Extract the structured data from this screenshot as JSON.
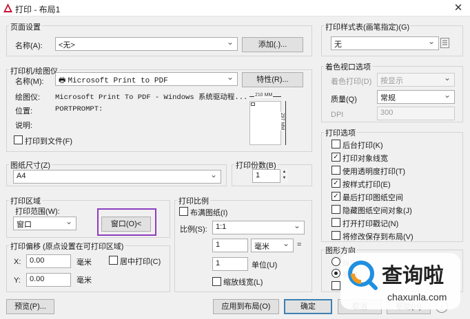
{
  "window": {
    "title": "打印 - 布局1",
    "close_glyph": "✕"
  },
  "page_setup": {
    "legend": "页面设置",
    "name_label": "名称(A):",
    "name_value": "<无>",
    "add_button": "添加(.)..."
  },
  "printer": {
    "legend": "打印机/绘图仪",
    "name_label": "名称(M):",
    "name_value": "Microsoft Print to PDF",
    "properties_button": "特性(R)...",
    "plotter_label": "绘图仪:",
    "plotter_value": "Microsoft Print To PDF - Windows 系统驱动程...",
    "location_label": "位置:",
    "location_value": "PORTPROMPT:",
    "description_label": "说明:",
    "print_to_file": "打印到文件(F)",
    "print_to_file_checked": false,
    "paper_width": "210 MM",
    "paper_height": "297 MM"
  },
  "paper_size": {
    "legend": "图纸尺寸(Z)",
    "value": "A4"
  },
  "copies": {
    "legend": "打印份数(B)",
    "value": "1"
  },
  "print_area": {
    "legend": "打印区域",
    "range_label": "打印范围(W):",
    "range_value": "窗口",
    "window_button": "窗口(O)<"
  },
  "print_offset": {
    "legend": "打印偏移 (原点设置在可打印区域)",
    "x_label": "X:",
    "x_value": "0.00",
    "x_unit": "毫米",
    "y_label": "Y:",
    "y_value": "0.00",
    "y_unit": "毫米",
    "center_label": "居中打印(C)",
    "center_checked": false
  },
  "scale": {
    "legend": "打印比例",
    "fit_label": "布满图纸(I)",
    "fit_checked": false,
    "ratio_label": "比例(S):",
    "ratio_value": "1:1",
    "value1": "1",
    "unit1": "毫米",
    "equals": "=",
    "value2": "1",
    "unit2": "单位(U)",
    "scale_lineweights": "缩放线宽(L)",
    "scale_lineweights_checked": false
  },
  "plot_style": {
    "legend": "打印样式表(画笔指定)(G)",
    "value": "无"
  },
  "shaded_viewport": {
    "legend": "着色视口选项",
    "shade_label": "着色打印(D)",
    "shade_value": "按显示",
    "quality_label": "质量(Q)",
    "quality_value": "常规",
    "dpi_label": "DPI",
    "dpi_value": "300"
  },
  "print_options": {
    "legend": "打印选项",
    "items": [
      {
        "label": "后台打印(K)",
        "checked": false
      },
      {
        "label": "打印对象线宽",
        "checked": true
      },
      {
        "label": "使用透明度打印(T)",
        "checked": false
      },
      {
        "label": "按样式打印(E)",
        "checked": true
      },
      {
        "label": "最后打印图纸空间",
        "checked": true
      },
      {
        "label": "隐藏图纸空间对象(J)",
        "checked": false
      },
      {
        "label": "打开打印戳记(N)",
        "checked": false
      },
      {
        "label": "将修改保存到布局(V)",
        "checked": false
      }
    ]
  },
  "orientation": {
    "legend": "图形方向",
    "opt1": "纵向",
    "opt2": "横向"
  },
  "buttons": {
    "preview": "预览(P)...",
    "apply": "应用到布局(O)",
    "ok": "确定",
    "cancel": "取消",
    "help": "帮助(H)"
  },
  "watermark": {
    "text": "查询啦",
    "url": "chaxunla.com"
  },
  "colors": {
    "annotation": "#8e3bbf",
    "watermark_blue": "#1f8fe0",
    "watermark_orange": "#f39a1e"
  }
}
